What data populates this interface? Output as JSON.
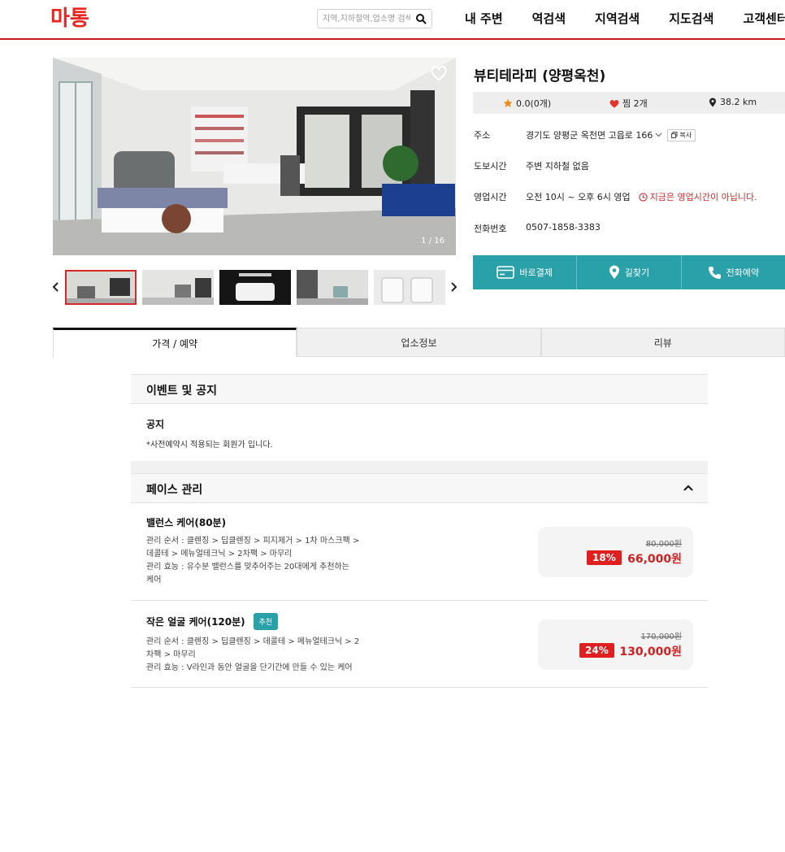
{
  "header": {
    "logo_text": "마통",
    "search_placeholder": "지역,지하철역,업소명 검색",
    "nav": [
      "내 주변",
      "역검색",
      "지역검색",
      "지도검색",
      "고객센터"
    ]
  },
  "gallery": {
    "counter": "1 / 16"
  },
  "shop": {
    "title": "뷰티테라피 (양평옥천)",
    "rating": "0.0(0개)",
    "likes": "찜 2개",
    "distance": "38.2 km",
    "address_label": "주소",
    "address": "경기도 양평군 옥천면 고읍로 166",
    "copy_label": "복사",
    "walk_label": "도보시간",
    "walk": "주변 지하철 없음",
    "hours_label": "영업시간",
    "hours": "오전 10시 ~ 오후 6시 영업",
    "closed_notice": "지금은 영업시간이 아닙니다.",
    "phone_label": "전화번호",
    "phone": "0507-1858-3383"
  },
  "actions": [
    "바로결제",
    "길찾기",
    "전화예약"
  ],
  "tabs": [
    "가격 / 예약",
    "업소정보",
    "리뷰"
  ],
  "notice_section": {
    "title": "이벤트 및 공지",
    "notice_title": "공지",
    "notice_body": "*사전예약시 적용되는 회원가 입니다."
  },
  "menu_section": {
    "title": "페이스 관리",
    "items": [
      {
        "name": "밸런스 케어(80분)",
        "desc_lines": [
          "관리 순서 : 클렌징 > 딥클렌징 > 피지제거 > 1차 마스크팩 >",
          "데콜테 > 메뉴얼테크닉 > 2차팩 > 마무리",
          "관리 효능 : 유수분 밸런스를 맞추어주는 20대에게 추천하는",
          "케어"
        ],
        "original_price": "80,000원",
        "discount": "18%",
        "price": "66,000원"
      },
      {
        "name": "작은 얼굴 케어(120분)",
        "badge": "추천",
        "desc_lines": [
          "관리 순서 : 클렌징 > 딥클렌징 > 데콜테 > 메뉴얼테크닉 > 2",
          "차팩 > 마무리",
          "관리 효능 : V라인과 동안 얼굴을 단기간에 만들 수 있는 케어"
        ],
        "original_price": "170,000원",
        "discount": "24%",
        "price": "130,000원"
      }
    ]
  },
  "colors": {
    "brand": "#c8191f",
    "teal": "#2aa0a8",
    "sale": "#e02020"
  }
}
